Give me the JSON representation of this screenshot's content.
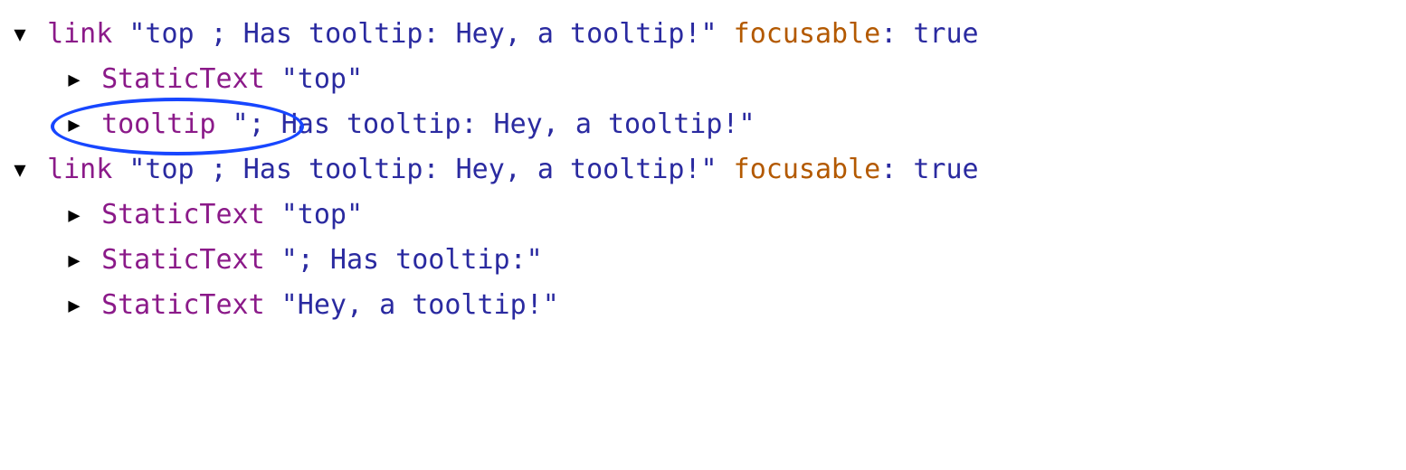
{
  "nodes": {
    "link1": {
      "role": "link",
      "name": "\"top ; Has tooltip: Hey, a tooltip!\"",
      "attr": "focusable",
      "attr_val": "true"
    },
    "link1_c1": {
      "role": "StaticText",
      "name": "\"top\""
    },
    "link1_c2": {
      "role": "tooltip",
      "name": "\"; Has tooltip: Hey, a tooltip!\""
    },
    "link2": {
      "role": "link",
      "name": "\"top ; Has tooltip: Hey, a tooltip!\"",
      "attr": "focusable",
      "attr_val": "true"
    },
    "link2_c1": {
      "role": "StaticText",
      "name": "\"top\""
    },
    "link2_c2": {
      "role": "StaticText",
      "name": "\"; Has tooltip:\""
    },
    "link2_c3": {
      "role": "StaticText",
      "name": "\"Hey, a tooltip!\""
    }
  }
}
